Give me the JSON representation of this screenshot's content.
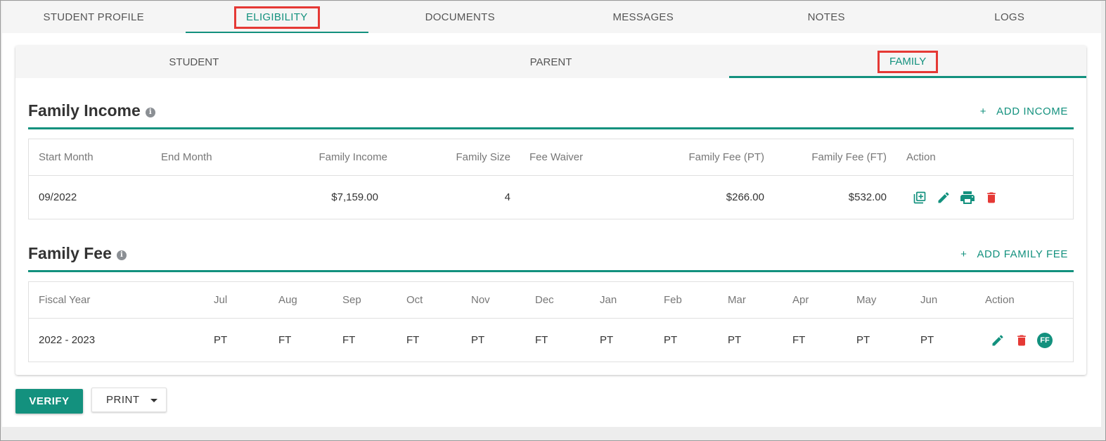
{
  "top_tabs": [
    {
      "label": "STUDENT PROFILE"
    },
    {
      "label": "ELIGIBILITY"
    },
    {
      "label": "DOCUMENTS"
    },
    {
      "label": "MESSAGES"
    },
    {
      "label": "NOTES"
    },
    {
      "label": "LOGS"
    }
  ],
  "sub_tabs": [
    {
      "label": "STUDENT"
    },
    {
      "label": "PARENT"
    },
    {
      "label": "FAMILY"
    }
  ],
  "family_income": {
    "title": "Family Income",
    "add_label": "ADD INCOME",
    "columns": [
      "Start Month",
      "End Month",
      "Family Income",
      "Family Size",
      "Fee Waiver",
      "Family Fee (PT)",
      "Family Fee (FT)",
      "Action"
    ],
    "rows": [
      {
        "start_month": "09/2022",
        "end_month": "",
        "family_income": "$7,159.00",
        "family_size": "4",
        "fee_waiver": "",
        "fee_pt": "$266.00",
        "fee_ft": "$532.00"
      }
    ],
    "actions": [
      "add-box-icon",
      "edit-icon",
      "print-icon",
      "delete-icon"
    ]
  },
  "family_fee": {
    "title": "Family Fee",
    "add_label": "ADD FAMILY FEE",
    "columns": [
      "Fiscal Year",
      "Jul",
      "Aug",
      "Sep",
      "Oct",
      "Nov",
      "Dec",
      "Jan",
      "Feb",
      "Mar",
      "Apr",
      "May",
      "Jun",
      "Action"
    ],
    "rows": [
      {
        "fiscal_year": "2022 - 2023",
        "months": [
          "PT",
          "FT",
          "FT",
          "FT",
          "PT",
          "FT",
          "PT",
          "PT",
          "PT",
          "FT",
          "PT",
          "PT"
        ],
        "badge": "FF"
      }
    ],
    "actions": [
      "edit-icon",
      "delete-icon",
      "ff-badge"
    ]
  },
  "buttons": {
    "verify": "VERIFY",
    "print": "PRINT"
  },
  "colors": {
    "accent": "#13917e",
    "delete": "#e53935",
    "highlight": "#e53935"
  }
}
